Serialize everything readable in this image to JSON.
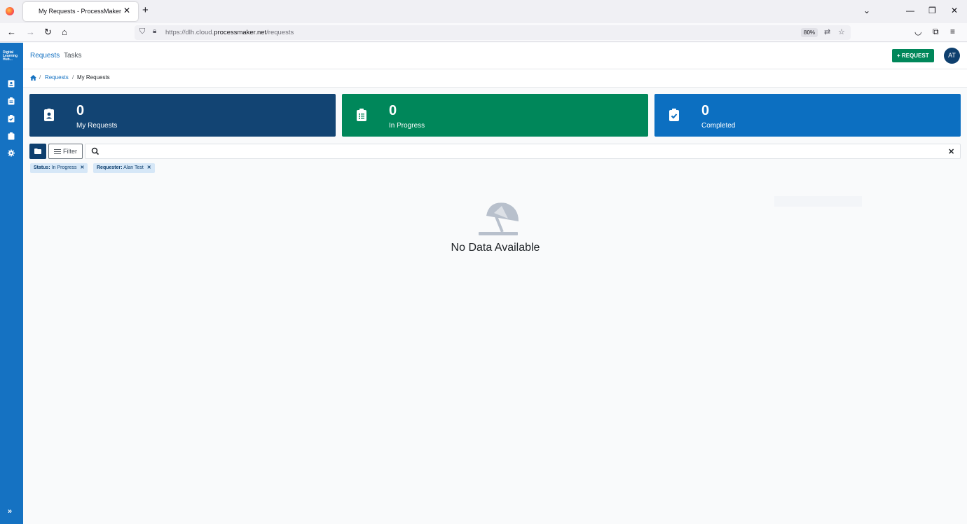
{
  "browser": {
    "tab_title": "My Requests - ProcessMaker",
    "url_prefix": "https://dlh.cloud.",
    "url_domain": "processmaker.net",
    "url_path": "/requests",
    "zoom": "80%"
  },
  "sidebar": {
    "logo_text": "Digital Learning Hub...",
    "items": [
      {
        "icon": "id-card-icon"
      },
      {
        "icon": "clipboard-icon"
      },
      {
        "icon": "clipboard-check-icon"
      },
      {
        "icon": "clipboard-list-icon"
      },
      {
        "icon": "cog-icon"
      }
    ]
  },
  "topnav": {
    "links": [
      "Requests",
      "Tasks"
    ],
    "request_button": "REQUEST",
    "avatar_initials": "AT"
  },
  "breadcrumb": {
    "items": [
      "Requests",
      "My Requests"
    ]
  },
  "cards": [
    {
      "count": "0",
      "label": "My Requests",
      "color": "#124473",
      "icon": "id-card-icon"
    },
    {
      "count": "0",
      "label": "In Progress",
      "color": "#00875a",
      "icon": "clipboard-list-icon"
    },
    {
      "count": "0",
      "label": "Completed",
      "color": "#0c6fc1",
      "icon": "clipboard-check-icon"
    }
  ],
  "filters": {
    "filter_button": "Filter",
    "search_placeholder": "",
    "pills": [
      {
        "key": "Status:",
        "value": "In Progress"
      },
      {
        "key": "Requester:",
        "value": "Alan Test"
      }
    ]
  },
  "empty_state": {
    "icon": "beach-umbrella-icon",
    "message": "No Data Available"
  },
  "colors": {
    "primary": "#1572c2",
    "dark": "#0e3f6e",
    "success": "#00875a"
  }
}
